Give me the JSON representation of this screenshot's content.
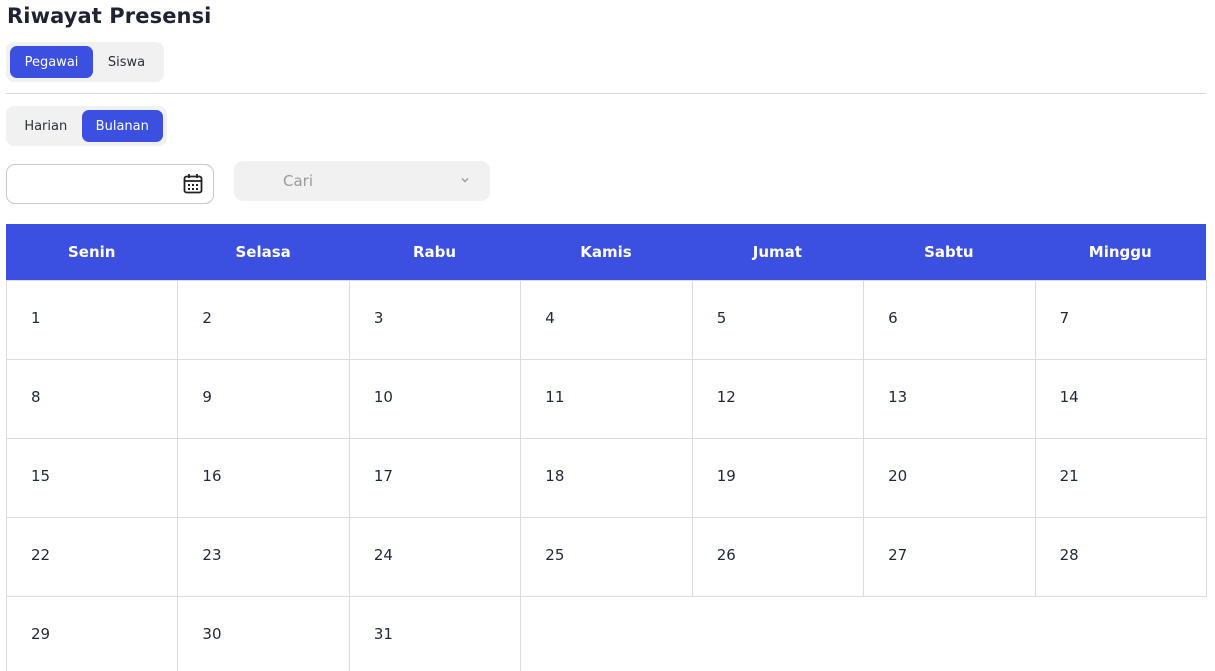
{
  "page": {
    "title": "Riwayat Presensi"
  },
  "role_tabs": [
    {
      "label": "Pegawai",
      "active": true
    },
    {
      "label": "Siswa",
      "active": false
    }
  ],
  "period_tabs": [
    {
      "label": "Harian",
      "active": false
    },
    {
      "label": "Bulanan",
      "active": true
    }
  ],
  "filters": {
    "date_value": "",
    "date_icon": "calendar-icon",
    "search_placeholder": "Cari",
    "search_icon": "chevron-down-icon"
  },
  "calendar": {
    "weekdays": [
      "Senin",
      "Selasa",
      "Rabu",
      "Kamis",
      "Jumat",
      "Sabtu",
      "Minggu"
    ],
    "days": [
      "1",
      "2",
      "3",
      "4",
      "5",
      "6",
      "7",
      "8",
      "9",
      "10",
      "11",
      "12",
      "13",
      "14",
      "15",
      "16",
      "17",
      "18",
      "19",
      "20",
      "21",
      "22",
      "23",
      "24",
      "25",
      "26",
      "27",
      "28",
      "29",
      "30",
      "31"
    ]
  },
  "colors": {
    "accent": "#3b4fe0",
    "segment_bg": "#f1f1f1",
    "border": "#dcdcdc"
  }
}
